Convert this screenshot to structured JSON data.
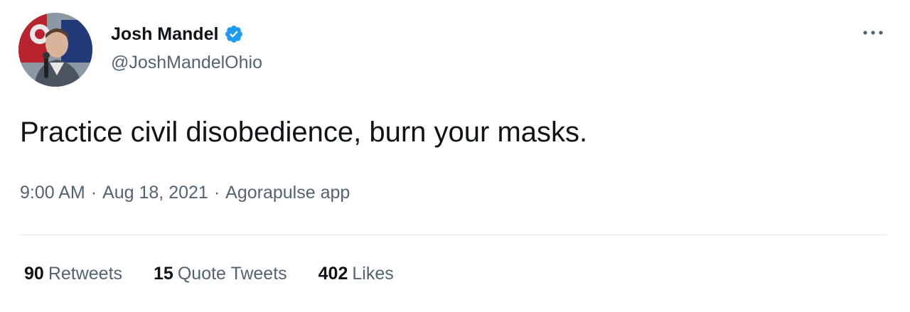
{
  "author": {
    "display_name": "Josh Mandel",
    "handle": "@JoshMandelOhio",
    "verified": true,
    "verified_color": "#1d9bf0",
    "avatar_icon": "profile-photo"
  },
  "tweet": {
    "text": "Practice civil disobedience, burn your masks.",
    "time": "9:00 AM",
    "date": "Aug 18, 2021",
    "source": "Agorapulse app",
    "separator": "·"
  },
  "stats": [
    {
      "count": "90",
      "label": "Retweets"
    },
    {
      "count": "15",
      "label": "Quote Tweets"
    },
    {
      "count": "402",
      "label": "Likes"
    }
  ],
  "menu": {
    "icon": "more-options-icon"
  }
}
